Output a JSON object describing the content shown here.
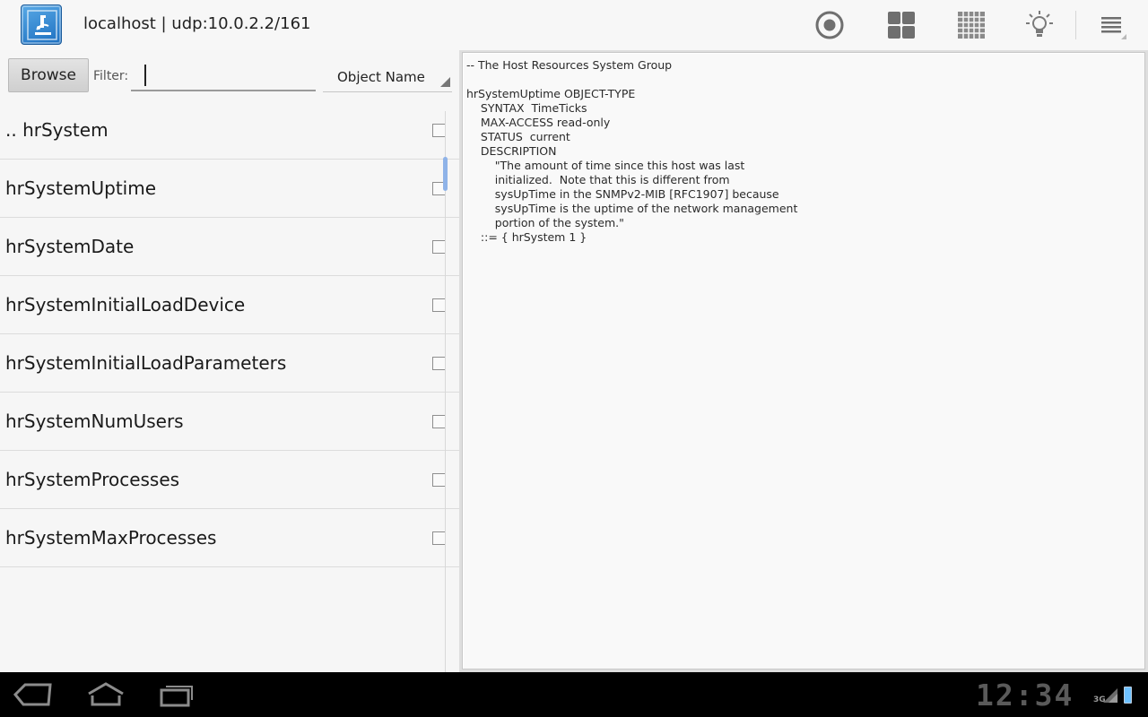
{
  "actionbar": {
    "app_icon": "microscope-app-icon",
    "title": "localhost | udp:10.0.2.2/161",
    "icons": [
      "record-icon",
      "dashboard-grid-icon",
      "table-grid-icon",
      "lightbulb-icon",
      "overflow-menu-icon"
    ]
  },
  "toolbar": {
    "browse_label": "Browse",
    "filter_label": "Filter:",
    "filter_value": "",
    "sort_selected": "Object Name"
  },
  "mib_list": {
    "items": [
      {
        "label": ".. hrSystem",
        "checked": false
      },
      {
        "label": "hrSystemUptime",
        "checked": false
      },
      {
        "label": "hrSystemDate",
        "checked": false
      },
      {
        "label": "hrSystemInitialLoadDevice",
        "checked": false
      },
      {
        "label": "hrSystemInitialLoadParameters",
        "checked": false
      },
      {
        "label": "hrSystemNumUsers",
        "checked": false
      },
      {
        "label": "hrSystemProcesses",
        "checked": false
      },
      {
        "label": "hrSystemMaxProcesses",
        "checked": false
      }
    ]
  },
  "detail": {
    "text": "-- The Host Resources System Group\n\nhrSystemUptime OBJECT-TYPE\n    SYNTAX  TimeTicks\n    MAX-ACCESS read-only\n    STATUS  current\n    DESCRIPTION\n        \"The amount of time since this host was last\n        initialized.  Note that this is different from\n        sysUpTime in the SNMPv2-MIB [RFC1907] because\n        sysUpTime is the uptime of the network management\n        portion of the system.\"\n    ::= { hrSystem 1 }"
  },
  "system_bar": {
    "clock": "12:34",
    "network": "3G",
    "icons": [
      "back-icon",
      "home-icon",
      "recent-apps-icon",
      "signal-icon",
      "battery-icon"
    ]
  }
}
